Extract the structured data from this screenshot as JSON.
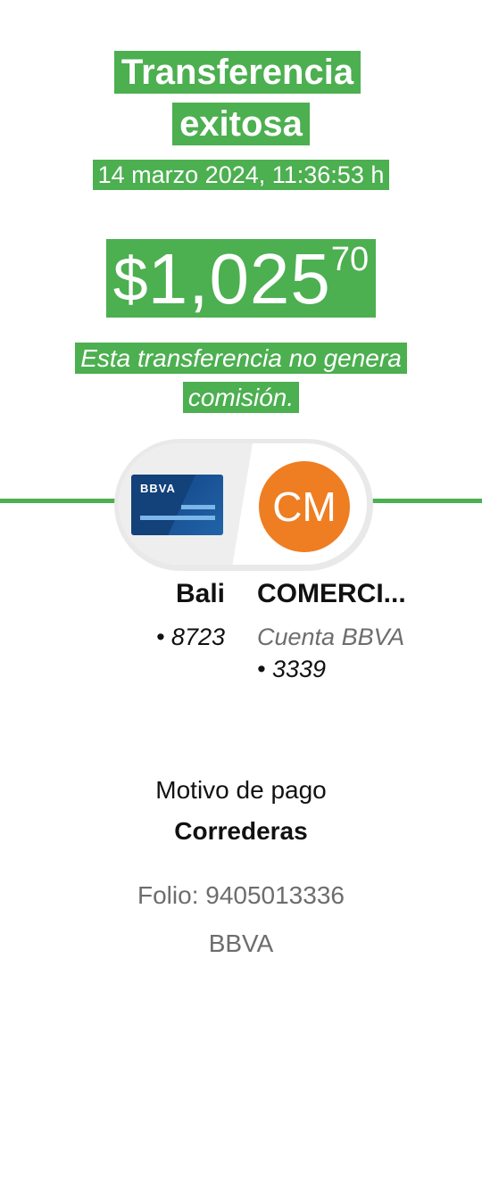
{
  "header": {
    "title": "Transferencia exitosa",
    "datetime": "14 marzo 2024, 11:36:53 h",
    "amount": {
      "currency": "$",
      "integer": "1,025",
      "decimals": "70"
    },
    "note": "Esta transferencia no genera comisión.",
    "accent_color": "#4caf50"
  },
  "source_account": {
    "card_logo": "BBVA",
    "name": "Bali",
    "number": "• 8723"
  },
  "destination_account": {
    "initials": "CM",
    "avatar_color": "#ef7d22",
    "name": "COMERCI...",
    "type": "Cuenta BBVA",
    "number": "• 3339"
  },
  "details": {
    "motivo_label": "Motivo de pago",
    "motivo_value": "Correderas",
    "folio": "Folio: 9405013336",
    "bank": "BBVA"
  }
}
